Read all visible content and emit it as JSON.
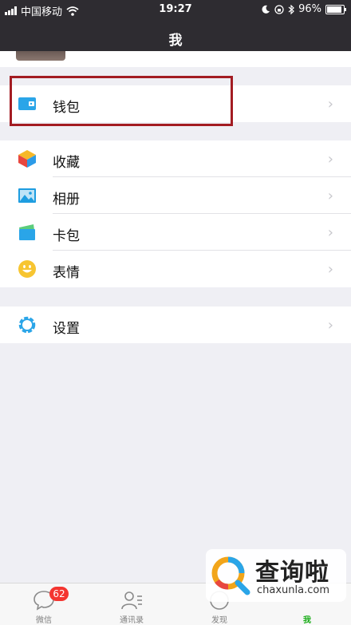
{
  "status_bar": {
    "carrier": "中国移动",
    "time": "19:27",
    "battery": "96%"
  },
  "nav": {
    "title": "我"
  },
  "groups": [
    [
      {
        "label": "钱包",
        "icon": "wallet-icon"
      }
    ],
    [
      {
        "label": "收藏",
        "icon": "favorites-cube-icon"
      },
      {
        "label": "相册",
        "icon": "album-icon"
      },
      {
        "label": "卡包",
        "icon": "card-pack-icon"
      },
      {
        "label": "表情",
        "icon": "smiley-icon"
      }
    ],
    [
      {
        "label": "设置",
        "icon": "gear-icon"
      }
    ]
  ],
  "tabbar": [
    {
      "label": "微信",
      "icon": "chat-bubble-icon",
      "badge": "62",
      "active": false
    },
    {
      "label": "通讯录",
      "icon": "contacts-icon",
      "active": false
    },
    {
      "label": "发现",
      "icon": "discover-icon",
      "active": false
    },
    {
      "label": "我",
      "icon": "me-icon",
      "active": true
    }
  ],
  "watermark": {
    "brand_cn": "查询啦",
    "brand_en": "chaxunla.com"
  },
  "colors": {
    "wechat_green": "#1aad19",
    "highlight_red": "#a31c22",
    "badge_red": "#f43530"
  }
}
